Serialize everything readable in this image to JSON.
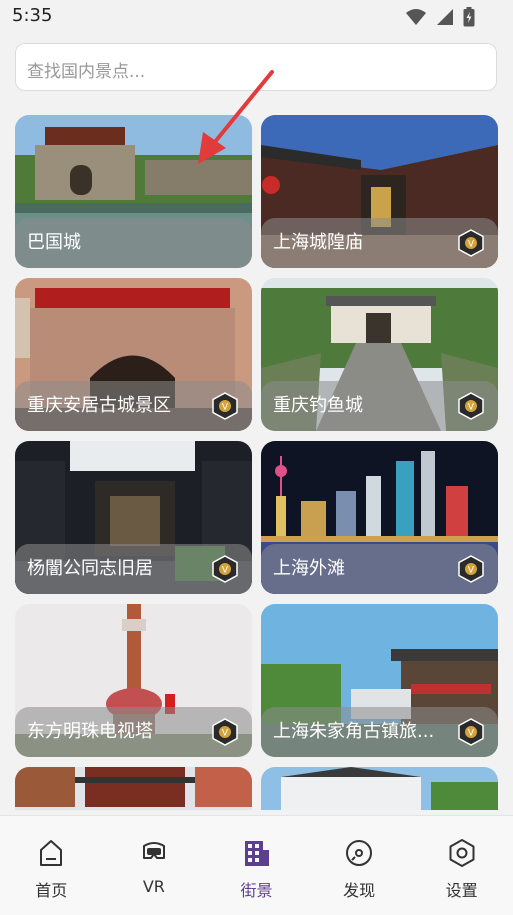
{
  "status_bar": {
    "time": "5:35"
  },
  "search": {
    "placeholder": "查找国内景点..."
  },
  "attractions": [
    {
      "title": "巴国城",
      "has_vr_badge": false
    },
    {
      "title": "上海城隍庙",
      "has_vr_badge": true
    },
    {
      "title": "重庆安居古城景区",
      "has_vr_badge": true
    },
    {
      "title": "重庆钓鱼城",
      "has_vr_badge": true
    },
    {
      "title": "杨闇公同志旧居",
      "has_vr_badge": true
    },
    {
      "title": "上海外滩",
      "has_vr_badge": true
    },
    {
      "title": "东方明珠电视塔",
      "has_vr_badge": true
    },
    {
      "title": "上海朱家角古镇旅...",
      "has_vr_badge": true
    },
    {
      "title": "",
      "has_vr_badge": false
    },
    {
      "title": "",
      "has_vr_badge": false
    }
  ],
  "bottom_nav": {
    "active": "街景",
    "accent_color": "#5d3f8f",
    "items": [
      {
        "label": "首页",
        "icon": "home-icon"
      },
      {
        "label": "VR",
        "icon": "vr-headset-icon"
      },
      {
        "label": "街景",
        "icon": "buildings-icon"
      },
      {
        "label": "发现",
        "icon": "compass-icon"
      },
      {
        "label": "设置",
        "icon": "settings-hexagon-icon"
      }
    ]
  }
}
